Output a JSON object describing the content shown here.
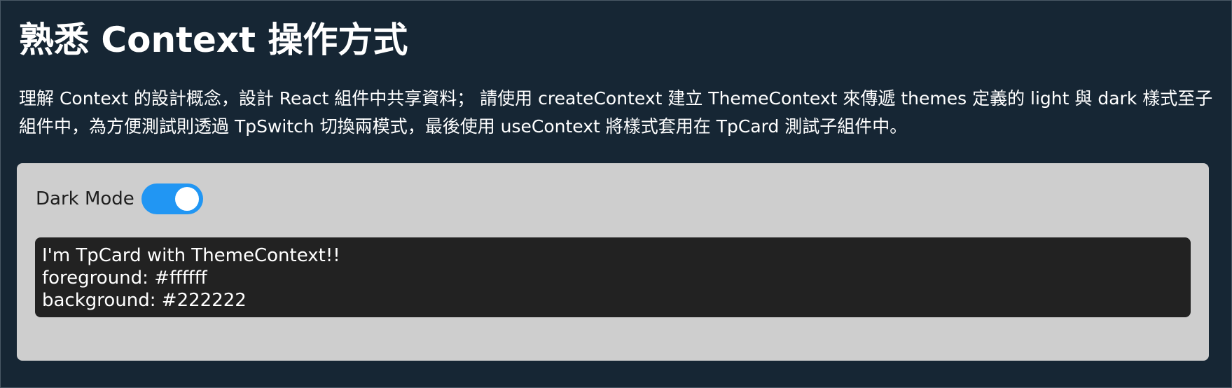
{
  "page": {
    "title": "熟悉 Context 操作方式",
    "description": "理解 Context 的設計概念，設計 React 組件中共享資料； 請使用 createContext 建立 ThemeContext 來傳遞 themes 定義的 light 與 dark 樣式至子組件中，為方便測試則透過 TpSwitch 切換兩模式，最後使用 useContext 將樣式套用在 TpCard 測試子組件中。"
  },
  "toggle": {
    "label": "Dark Mode",
    "checked": true,
    "color": "#2196f3"
  },
  "card": {
    "line1": "I'm TpCard with ThemeContext!!",
    "line2": "foreground: #ffffff",
    "line3": "background: #222222",
    "foreground": "#ffffff",
    "background": "#222222"
  },
  "colors": {
    "page_background": "#162634",
    "panel_background": "#cecece"
  }
}
